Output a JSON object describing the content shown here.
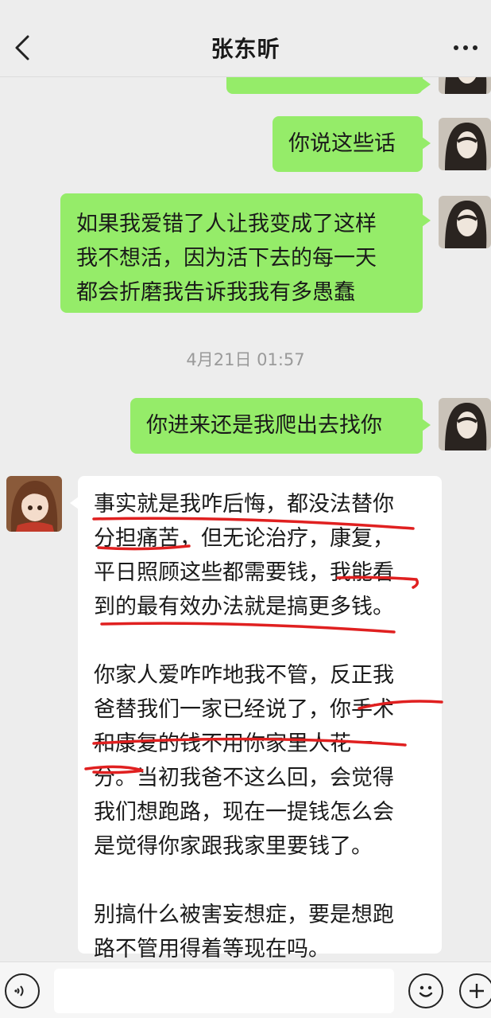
{
  "header": {
    "title": "张东昕",
    "back_icon": "chevron-left-icon",
    "more_icon": "more-dots-icon"
  },
  "messages": [
    {
      "direction": "out",
      "text": "你说这些话"
    },
    {
      "direction": "out",
      "lines": [
        "如果我爱错了人让我变成了这样",
        "我不想活，因为活下去的每一天",
        "都会折磨我告诉我我有多愚蠢"
      ]
    },
    {
      "direction": "out",
      "text": "你进来还是我爬出去找你"
    },
    {
      "direction": "in",
      "paragraphs": [
        [
          "事实就是我咋后悔，都没法替你",
          "分担痛苦，但无论治疗，康复，",
          "平日照顾这些都需要钱，我能看",
          "到的最有效办法就是搞更多钱。"
        ],
        [
          "你家人爱咋咋地我不管，反正我",
          "爸替我们一家已经说了，你手术",
          "和康复的钱不用你家里人花一",
          "分。当初我爸不这么回，会觉得",
          "我们想跑路，现在一提钱怎么会",
          "是觉得你家跟我家里要钱了。"
        ],
        [
          "别搞什么被害妄想症，要是想跑",
          "路不管用得着等现在吗。"
        ]
      ]
    }
  ],
  "timestamp": "4月21日 01:57",
  "colors": {
    "background": "#ededed",
    "outgoing_bubble": "#95ec69",
    "incoming_bubble": "#ffffff",
    "annotation_red": "#e02020"
  },
  "bottom_bar": {
    "voice_icon": "voice-icon",
    "emoji_icon": "emoji-icon",
    "plus_icon": "plus-icon"
  }
}
